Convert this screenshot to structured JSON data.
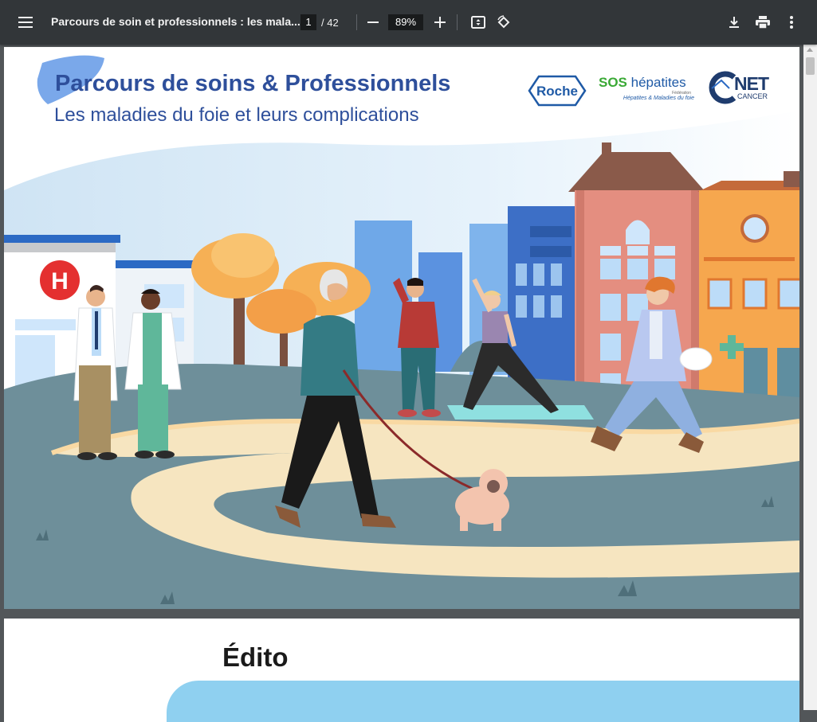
{
  "toolbar": {
    "document_title": "Parcours de soin et professionnels : les mala...",
    "current_page": "1",
    "page_total": "/ 42",
    "zoom_level": "89%",
    "icons": [
      "menu-icon",
      "zoom-out-icon",
      "zoom-in-icon",
      "fit-page-icon",
      "rotate-icon",
      "download-icon",
      "print-icon",
      "more-options-icon"
    ]
  },
  "page1": {
    "title": "Parcours de soins & Professionnels",
    "subtitle": "Les maladies du foie et leurs complications",
    "logos": {
      "roche": "Roche",
      "sos_brand": "SOS",
      "sos_word": "hépatites",
      "sos_federation": "Fédération",
      "sos_tagline": "Hépatites & Maladies du foie",
      "net_brand": "NET",
      "net_cancer": "CANCER"
    },
    "hospital_sign": "H",
    "colors": {
      "title_blue": "#2e4f9b",
      "sky": "#dceef8",
      "path": "#f6e5c0",
      "grass": "#6e8f9a"
    }
  },
  "page2": {
    "heading": "Édito"
  }
}
